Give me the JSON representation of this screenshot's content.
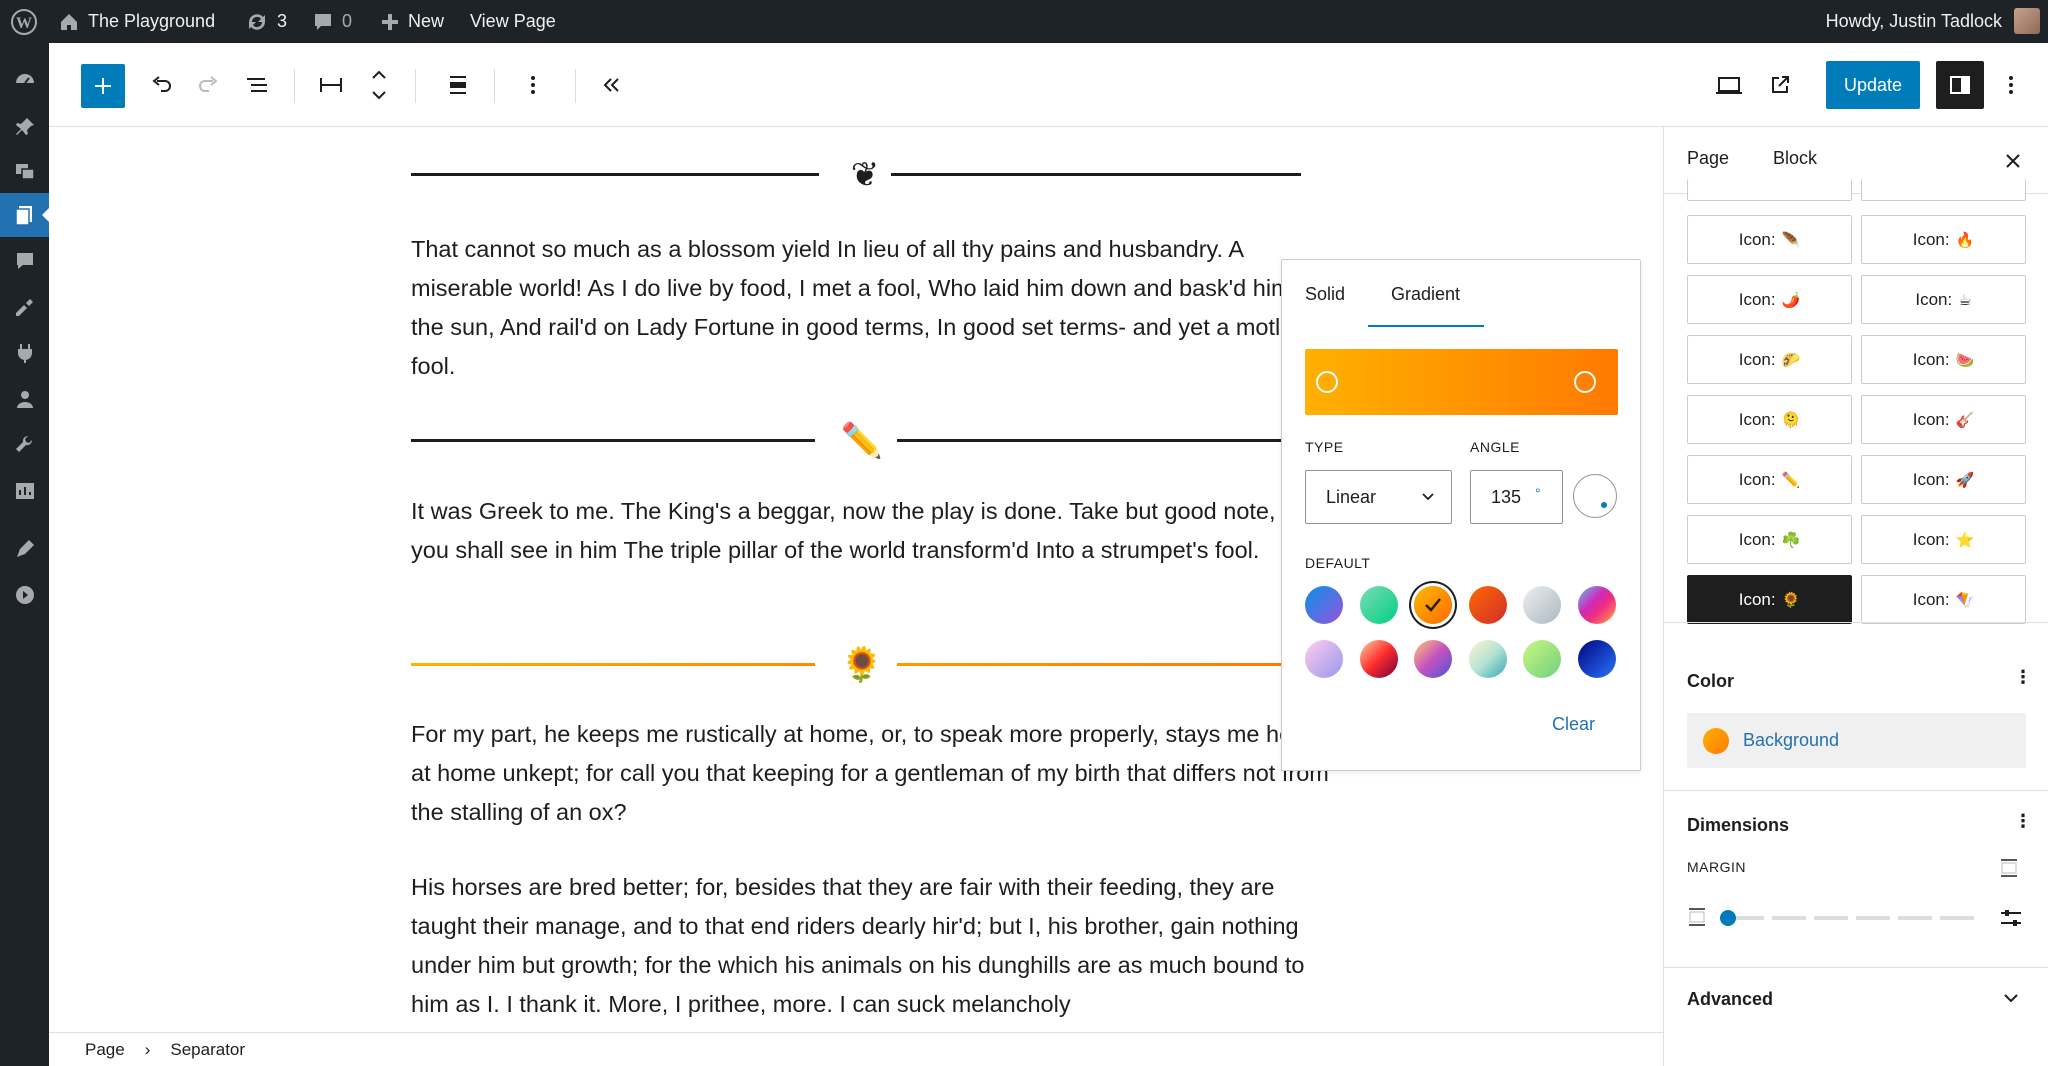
{
  "admin_bar": {
    "site_name": "The Playground",
    "updates_count": "3",
    "comments_count": "0",
    "new_label": "New",
    "view_label": "View Page",
    "greeting": "Howdy, Justin Tadlock"
  },
  "toolbar": {
    "update_label": "Update"
  },
  "content": {
    "paragraphs": [
      "That cannot so much as a blossom yield In lieu of all thy pains and husbandry. A miserable world! As I do live by food, I met a fool, Who laid him down and bask'd him in the sun, And rail'd on Lady Fortune in good terms, In good set terms- and yet a motley fool.",
      "It was Greek to me. The King's a beggar, now the play is done. Take but good note, and you shall see in him The triple pillar of the world transform'd Into a strumpet's fool.",
      "For my part, he keeps me rustically at home, or, to speak more properly, stays me here at home unkept; for call you that keeping for a gentleman of my birth that differs not from the stalling of an ox?",
      "His horses are bred better; for, besides that they are fair with their feeding, they are taught their manage, and to that end riders dearly hir'd; but I, his brother, gain nothing under him but growth; for the which his animals on his dunghills are as much bound to him as I. I thank it. More, I prithee, more. I can suck melancholy"
    ],
    "separators": [
      "❦",
      "✏️",
      "🌻"
    ]
  },
  "breadcrumb": {
    "root": "Page",
    "separator_glyph": "›",
    "current": "Separator"
  },
  "color_popover": {
    "tabs": [
      "Solid",
      "Gradient"
    ],
    "active_tab": "Gradient",
    "type_label": "TYPE",
    "type_value": "Linear",
    "angle_label": "ANGLE",
    "angle_value": "135",
    "angle_unit": "°",
    "default_label": "DEFAULT",
    "clear_label": "Clear",
    "gradient_from": "#ffb000",
    "gradient_to": "#ff7a00",
    "swatches": [
      {
        "name": "vivid-cyan-blue-to-vivid-purple",
        "css": "linear-gradient(135deg,#0693e3,#9b51e0)"
      },
      {
        "name": "light-green-cyan-to-vivid-green-cyan",
        "css": "linear-gradient(135deg,#7adcb4,#00d082)"
      },
      {
        "name": "luminous-vivid-amber-to-luminous-vivid-orange",
        "css": "linear-gradient(135deg,#fcb900,#ff6900)",
        "selected": true
      },
      {
        "name": "luminous-vivid-orange-to-vivid-red",
        "css": "linear-gradient(135deg,#ff6900,#cf2e2e)"
      },
      {
        "name": "very-light-gray-to-cyan-bluish-gray",
        "css": "linear-gradient(135deg,#eeeeee,#a9b8c3)"
      },
      {
        "name": "cool-to-warm-spectrum",
        "css": "linear-gradient(135deg,#4aeadc,#9778d1,#cf2aba,#ee2c82,#fb6962,#fef84c)"
      },
      {
        "name": "blush-light-purple",
        "css": "linear-gradient(135deg,#ffceec,#9896f0)"
      },
      {
        "name": "blush-bordeaux",
        "css": "linear-gradient(135deg,#fecda5,#fe2d2d,#6b003e)"
      },
      {
        "name": "luminous-dusk",
        "css": "linear-gradient(135deg,#ffcb70,#c751c0,#4158d0)"
      },
      {
        "name": "pale-ocean",
        "css": "linear-gradient(135deg,#fff5cb,#b6e3d4,#33a7b5)"
      },
      {
        "name": "electric-grass",
        "css": "linear-gradient(135deg,#caf880,#71ce7e)"
      },
      {
        "name": "midnight",
        "css": "linear-gradient(135deg,#020381,#2874fc)"
      }
    ]
  },
  "sidebar": {
    "tabs": [
      "Page",
      "Block"
    ],
    "active_tab": "Block",
    "icon_buttons": [
      {
        "label": "Icon:",
        "emoji": "🪶"
      },
      {
        "label": "Icon:",
        "emoji": "🔥"
      },
      {
        "label": "Icon:",
        "emoji": "🌶️"
      },
      {
        "label": "Icon:",
        "emoji": "☕"
      },
      {
        "label": "Icon:",
        "emoji": "🌮"
      },
      {
        "label": "Icon:",
        "emoji": "🍉"
      },
      {
        "label": "Icon:",
        "emoji": "🫠"
      },
      {
        "label": "Icon:",
        "emoji": "🎸"
      },
      {
        "label": "Icon:",
        "emoji": "✏️"
      },
      {
        "label": "Icon:",
        "emoji": "🚀"
      },
      {
        "label": "Icon:",
        "emoji": "☘️"
      },
      {
        "label": "Icon:",
        "emoji": "⭐"
      },
      {
        "label": "Icon:",
        "emoji": "🌻",
        "active": true
      },
      {
        "label": "Icon:",
        "emoji": "🪁"
      }
    ],
    "color_title": "Color",
    "background_label": "Background",
    "dimensions_title": "Dimensions",
    "margin_label": "MARGIN",
    "advanced_title": "Advanced"
  }
}
